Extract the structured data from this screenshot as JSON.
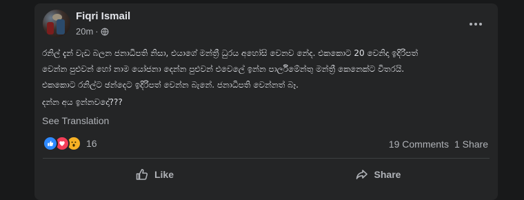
{
  "post": {
    "author": "Fiqri Ismail",
    "time": "20m",
    "separator": "·",
    "privacy_icon": "globe-icon",
    "body": "රනිල් දැන් වැඩ බලන ජනාධිපති නිසා, එයාගේ මන්ත්‍රී ධුරය අහෝසි වෙනව නේද. එකකොට 20 වෙනිදා ඉදිරිපත්\nවෙන්න පුළුවන් හෝ නාම යෝජනා දෙන්න පුළුවන් එවෙලේ ඉන්න පාර්ලිමේන්තු මන්ත්‍රී කෙනෙක්ට විතරයි.\nඑකකොට රනිල්ට ඡන්දෙට ඉදිරිපත් වෙන්න බැනේ. ජනාධිපති වෙන්නත් බෑ.",
    "question": "දන්න අය ඉන්නවදෝ???",
    "see_translation": "See Translation"
  },
  "reactions": {
    "icons": [
      "like-icon",
      "love-icon",
      "wow-icon"
    ],
    "count": "16",
    "colors": {
      "like": "#2e89ff",
      "love": "#f33e58",
      "wow": "#f7b125"
    }
  },
  "stats": {
    "comments": "19 Comments",
    "shares": "1 Share"
  },
  "actions": {
    "like_label": "Like",
    "share_label": "Share"
  },
  "theme": {
    "page_bg": "#18191a",
    "card_bg": "#242526",
    "text_primary": "#e4e6eb",
    "text_secondary": "#b0b3b8"
  }
}
